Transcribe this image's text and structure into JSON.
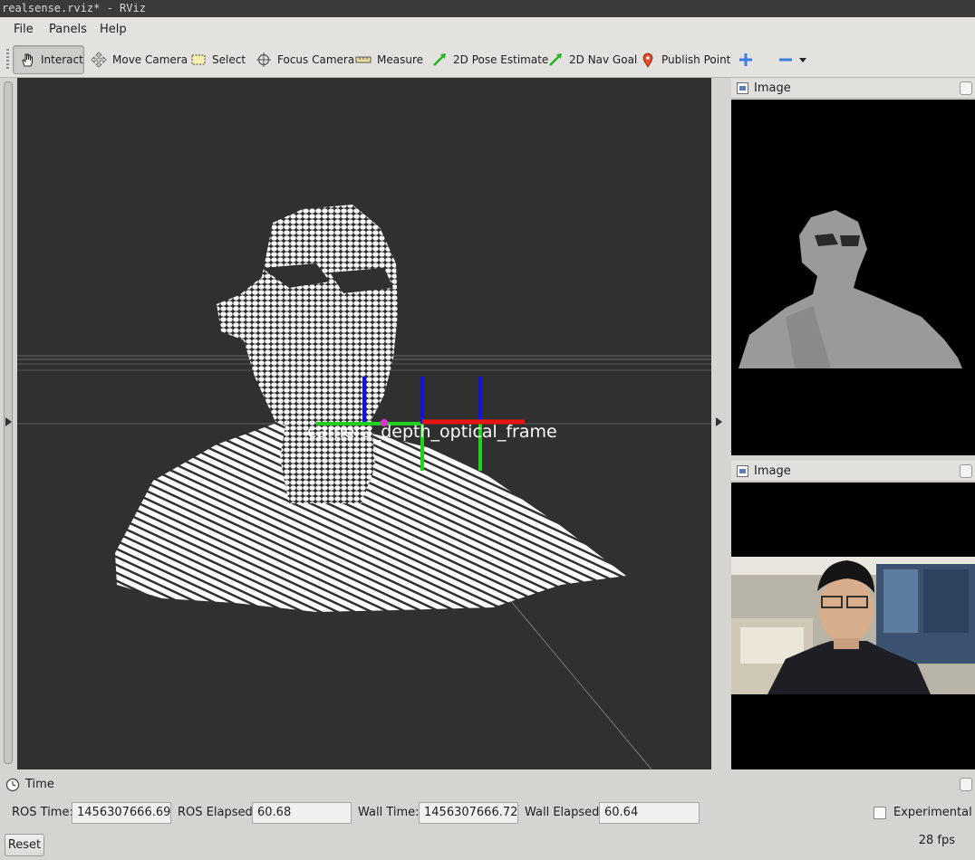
{
  "window": {
    "title": "realsense.rviz* - RViz"
  },
  "menu": [
    {
      "label": "File"
    },
    {
      "label": "Panels"
    },
    {
      "label": "Help"
    }
  ],
  "toolbar": {
    "interact": "Interact",
    "move_camera": "Move Camera",
    "select": "Select",
    "focus_camera": "Focus Camera",
    "measure": "Measure",
    "pose_estimate": "2D Pose Estimate",
    "nav_goal": "2D Nav Goal",
    "publish_point": "Publish Point"
  },
  "viewport": {
    "frame_labels": "camera_depth_optical_frame"
  },
  "panels": [
    {
      "title": "Image"
    },
    {
      "title": "Image"
    }
  ],
  "time": {
    "title": "Time",
    "ros_time_label": "ROS Time:",
    "ros_time": "1456307666.69",
    "ros_elapsed_label": "ROS Elapsed:",
    "ros_elapsed": "60.68",
    "wall_time_label": "Wall Time:",
    "wall_time": "1456307666.72",
    "wall_elapsed_label": "Wall Elapsed:",
    "wall_elapsed": "60.64",
    "experimental_label": "Experimental",
    "reset": "Reset",
    "fps": "28 fps"
  }
}
